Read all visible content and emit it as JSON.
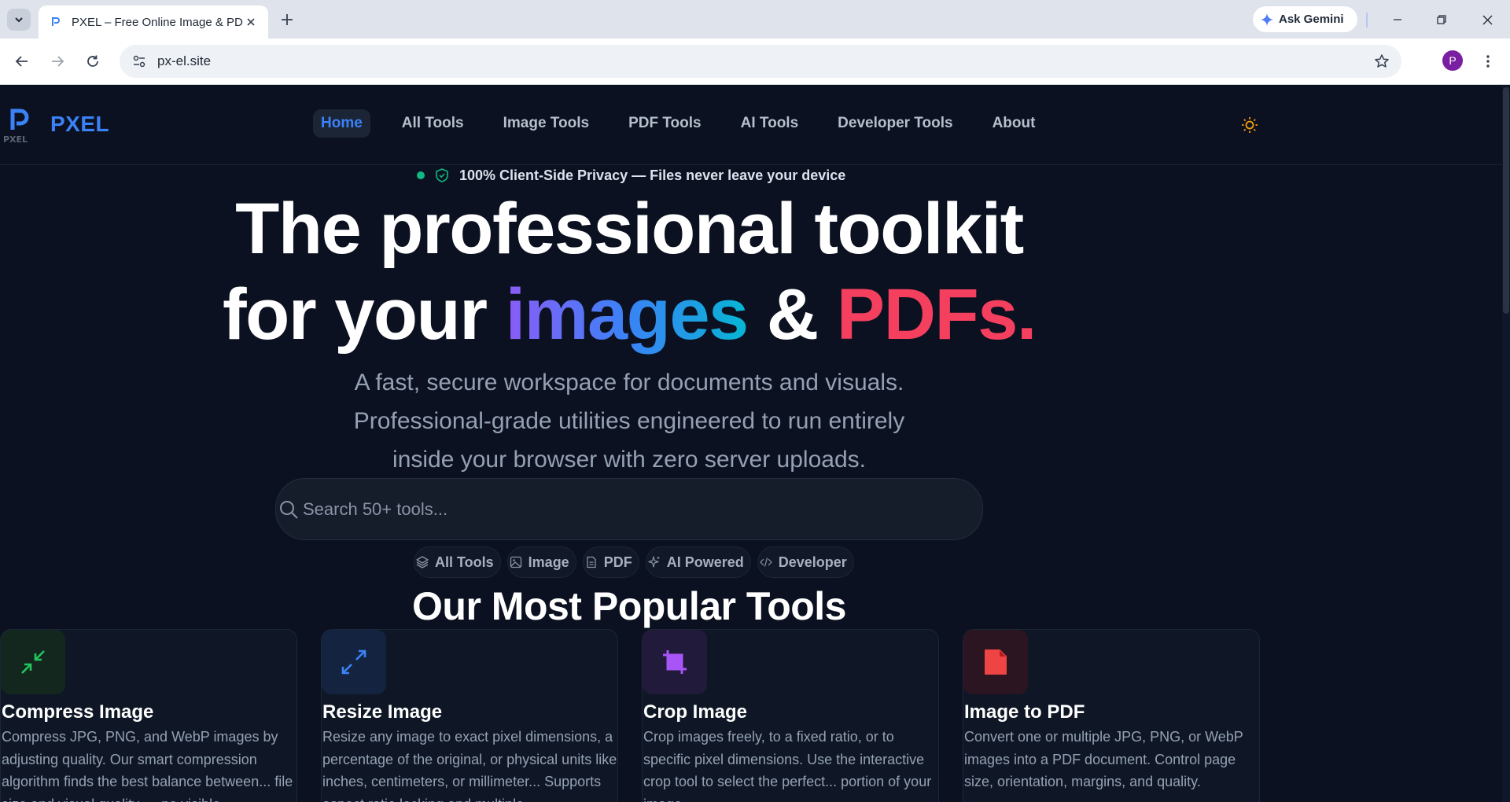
{
  "browser": {
    "tab_title": "PXEL – Free Online Image & PDF Tools",
    "new_tab_icon": "plus-icon",
    "gemini_label": "Ask Gemini",
    "url": "px-el.site",
    "profile_initial": "P"
  },
  "site": {
    "logo_text": "PXEL",
    "logo_small": "PXEL",
    "nav": [
      {
        "label": "Home",
        "active": true
      },
      {
        "label": "All Tools"
      },
      {
        "label": "Image Tools"
      },
      {
        "label": "PDF Tools"
      },
      {
        "label": "AI Tools"
      },
      {
        "label": "Developer Tools"
      },
      {
        "label": "About"
      }
    ],
    "privacy_badge": "100% Client-Side Privacy — Files never leave your device"
  },
  "hero": {
    "line1": "The professional toolkit",
    "line2_prefix": "for your ",
    "line2_images": "images",
    "line2_amp": " & ",
    "line2_pdfs": "PDFs.",
    "sub1": "A fast, secure workspace for documents and visuals.",
    "sub2": "Professional-grade utilities engineered to run entirely",
    "sub3": "inside your browser with zero server uploads."
  },
  "search": {
    "placeholder": "Search 50+ tools..."
  },
  "chips": [
    {
      "label": "All Tools",
      "icon": "layers-icon"
    },
    {
      "label": "Image",
      "icon": "image-icon"
    },
    {
      "label": "PDF",
      "icon": "file-icon"
    },
    {
      "label": "AI Powered",
      "icon": "sparkles-icon"
    },
    {
      "label": "Developer",
      "icon": "code-icon"
    }
  ],
  "popular": {
    "title": "Our Most Popular Tools",
    "cards": [
      {
        "title": "Compress Image",
        "desc": "Compress JPG, PNG, and WebP images by adjusting quality. Our smart compression algorithm finds the best balance between... file size and visual quality — no visible",
        "icon": "compress-icon",
        "accent": "#22c55e"
      },
      {
        "title": "Resize Image",
        "desc": "Resize any image to exact pixel dimensions, a percentage of the original, or physical units like inches, centimeters, or millimeter... Supports aspect ratio locking and multiple",
        "icon": "expand-icon",
        "accent": "#3b82f6"
      },
      {
        "title": "Crop Image",
        "desc": "Crop images freely, to a fixed ratio, or to specific pixel dimensions. Use the interactive crop tool to select the perfect... portion of your image.",
        "icon": "crop-icon",
        "accent": "#a855f7"
      },
      {
        "title": "Image to PDF",
        "desc": "Convert one or multiple JPG, PNG, or WebP images into a PDF document. Control page size, orientation, margins, and quality.",
        "icon": "pdf-file-icon",
        "accent": "#ef4444"
      }
    ]
  }
}
